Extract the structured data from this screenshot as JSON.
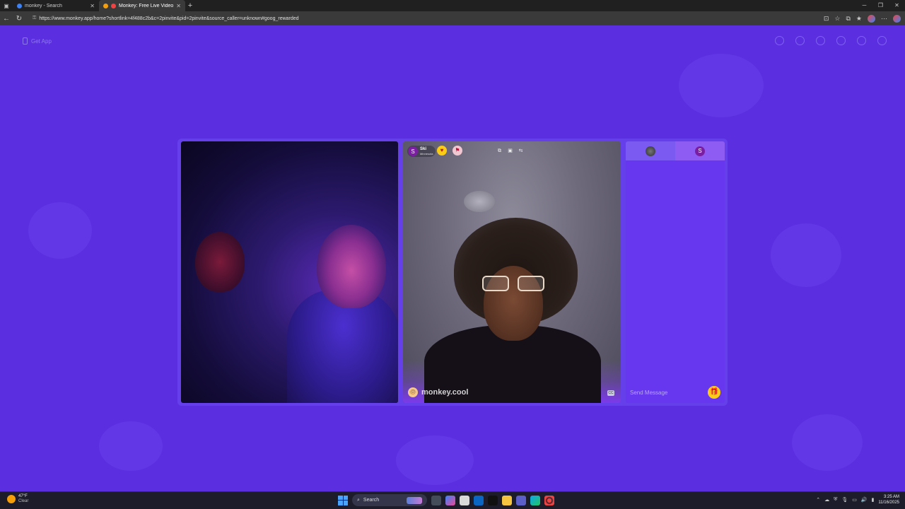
{
  "browser": {
    "tabs": [
      {
        "title": "monkey - Search",
        "active": false
      },
      {
        "title": "Monkey: Free Live Video Ch",
        "active": true
      }
    ],
    "url": "https://www.monkey.app/home?shortlink=4f488c2b&c=2pinvite&pid=2pinvite&source_caller=unknown#goog_rewarded"
  },
  "page": {
    "get_app_label": "Get App",
    "remote_user": {
      "initial": "S",
      "name": "Ski",
      "location": "Minnesota"
    },
    "watermark": "monkey.cool",
    "chat": {
      "tab2_initial": "S",
      "placeholder": "Send Message"
    },
    "colors": {
      "background": "#5b2fe0",
      "chat_panel": "#6637ee",
      "gift_button": "#facc15",
      "user_avatar": "#7b1fa2"
    }
  },
  "taskbar": {
    "weather_temp": "47°F",
    "weather_condition": "Clear",
    "search_label": "Search",
    "time": "3:25 AM",
    "date": "11/16/2025"
  }
}
